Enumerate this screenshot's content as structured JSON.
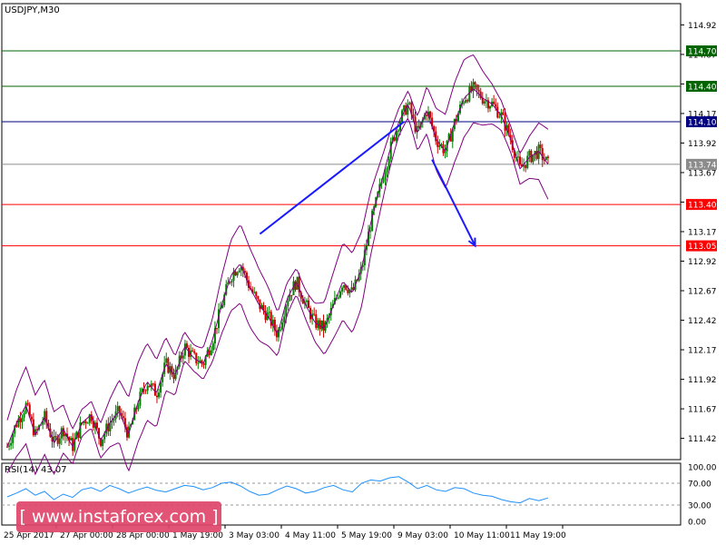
{
  "chart_data": [
    {
      "type": "candlestick",
      "title": "USDJPY,M30",
      "symbol": "USDJPY",
      "timeframe": "M30",
      "ylim": [
        111.24,
        115.1
      ],
      "yticks": [
        {
          "label": "114.92",
          "value": 114.92
        },
        {
          "label": "114.67",
          "value": 114.67
        },
        {
          "label": "114.42",
          "value": 114.42
        },
        {
          "label": "114.17",
          "value": 114.17
        },
        {
          "label": "113.92",
          "value": 113.92
        },
        {
          "label": "113.67",
          "value": 113.67
        },
        {
          "label": "113.42",
          "value": 113.42
        },
        {
          "label": "113.17",
          "value": 113.17
        },
        {
          "label": "112.92",
          "value": 112.92
        },
        {
          "label": "112.67",
          "value": 112.67
        },
        {
          "label": "112.42",
          "value": 112.42
        },
        {
          "label": "112.17",
          "value": 112.17
        },
        {
          "label": "111.92",
          "value": 111.92
        },
        {
          "label": "111.67",
          "value": 111.67
        },
        {
          "label": "111.42",
          "value": 111.42
        }
      ],
      "levels": [
        {
          "label": "114.70",
          "value": 114.7,
          "color": "#006400"
        },
        {
          "label": "114.40",
          "value": 114.4,
          "color": "#006400"
        },
        {
          "label": "114.10",
          "value": 114.1,
          "color": "#000080"
        },
        {
          "label": "113.74",
          "value": 113.74,
          "color": "#8c8c8c"
        },
        {
          "label": "113.40",
          "value": 113.4,
          "color": "#ff0000"
        },
        {
          "label": "113.05",
          "value": 113.05,
          "color": "#ff0000"
        }
      ],
      "xlabels": [
        "25 Apr 2017",
        "27 Apr 00:00",
        "28 Apr 00:00",
        "1 May 19:00",
        "3 May 03:00",
        "4 May 11:00",
        "5 May 19:00",
        "9 May 03:00",
        "10 May 11:00",
        "11 May 19:00"
      ],
      "close_path": [
        111.35,
        111.55,
        111.7,
        111.45,
        111.6,
        111.38,
        111.5,
        111.35,
        111.55,
        111.62,
        111.4,
        111.55,
        111.65,
        111.45,
        111.72,
        111.9,
        111.8,
        112.05,
        111.95,
        112.2,
        112.1,
        112.05,
        112.25,
        112.55,
        112.8,
        112.9,
        112.7,
        112.55,
        112.45,
        112.3,
        112.6,
        112.75,
        112.55,
        112.4,
        112.35,
        112.55,
        112.75,
        112.65,
        112.85,
        113.25,
        113.55,
        113.85,
        114.1,
        114.25,
        114.0,
        114.2,
        113.95,
        113.85,
        114.1,
        114.3,
        114.38,
        114.3,
        114.25,
        114.15,
        113.95,
        113.7,
        113.8,
        113.85,
        113.74
      ],
      "candle_count": 290,
      "bands_width": 0.28,
      "trend_line": [
        [
          135,
          113.15
        ],
        [
          212,
          114.1
        ]
      ],
      "arrow": [
        [
          227,
          113.78
        ],
        [
          250,
          113.05
        ]
      ],
      "trend_color": "#1a1aff",
      "band_color": "#800080",
      "bull_color": "#008000",
      "bear_color": "#cc0000"
    },
    {
      "type": "line",
      "title": "RSI(14) 43.07",
      "indicator": "RSI(14)",
      "value": "43.07",
      "ylim": [
        0,
        100
      ],
      "yticks": [
        {
          "label": "100.00",
          "value": 100
        },
        {
          "label": "70.00",
          "value": 70
        },
        {
          "label": "30.00",
          "value": 30
        },
        {
          "label": "0.00",
          "value": 0
        }
      ],
      "series": [
        {
          "values": [
            45,
            52,
            60,
            48,
            55,
            40,
            50,
            44,
            58,
            62,
            55,
            66,
            60,
            52,
            58,
            63,
            57,
            54,
            60,
            66,
            64,
            58,
            62,
            70,
            72,
            65,
            55,
            48,
            50,
            58,
            65,
            60,
            52,
            55,
            62,
            66,
            58,
            54,
            70,
            76,
            74,
            80,
            82,
            72,
            60,
            66,
            58,
            55,
            62,
            60,
            52,
            48,
            46,
            40,
            36,
            34,
            42,
            38,
            43.07
          ],
          "color": "#1e90ff"
        }
      ]
    }
  ],
  "watermark": {
    "text": "[  www.instaforex.com ]"
  }
}
